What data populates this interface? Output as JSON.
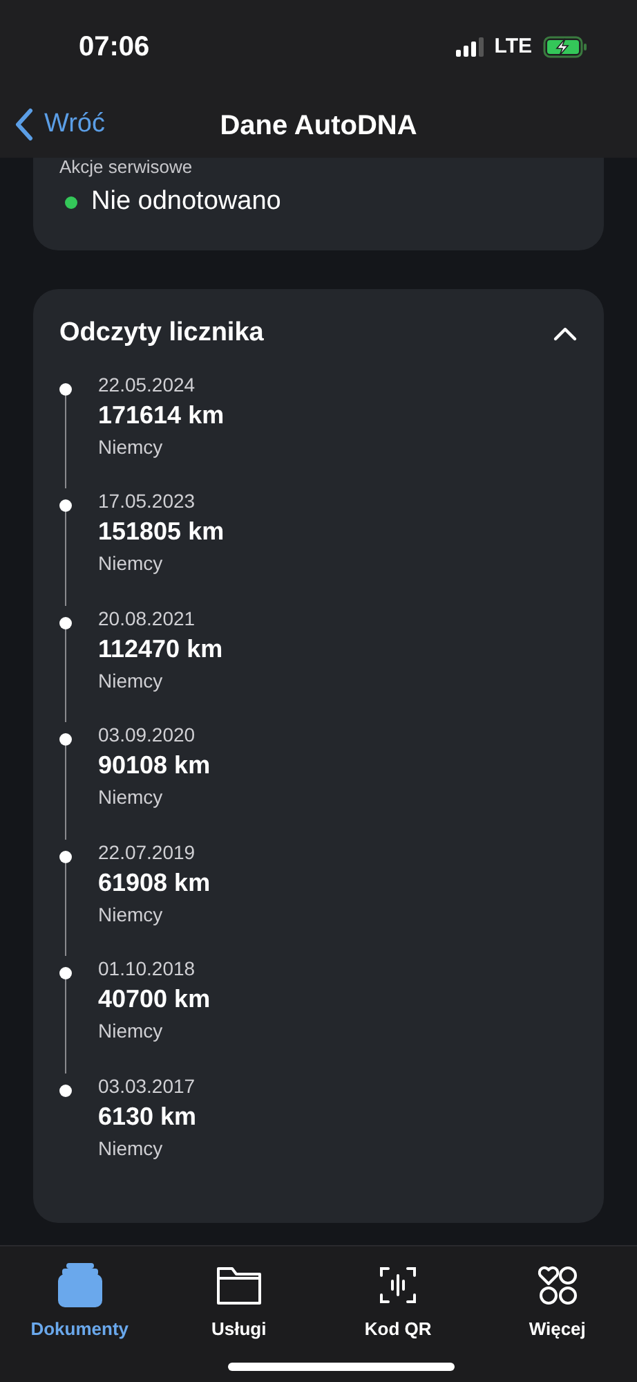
{
  "status_bar": {
    "time": "07:06",
    "network": "LTE"
  },
  "nav": {
    "back": "Wróć",
    "title": "Dane AutoDNA"
  },
  "service_card": {
    "label": "Akcje serwisowe",
    "value": "Nie odnotowano",
    "color": "#34c759"
  },
  "odometer": {
    "title": "Odczyty licznika",
    "expanded": true,
    "readings": [
      {
        "date": "22.05.2024",
        "mileage": "171614 km",
        "country": "Niemcy"
      },
      {
        "date": "17.05.2023",
        "mileage": "151805 km",
        "country": "Niemcy"
      },
      {
        "date": "20.08.2021",
        "mileage": "112470 km",
        "country": "Niemcy"
      },
      {
        "date": "03.09.2020",
        "mileage": "90108 km",
        "country": "Niemcy"
      },
      {
        "date": "22.07.2019",
        "mileage": "61908 km",
        "country": "Niemcy"
      },
      {
        "date": "01.10.2018",
        "mileage": "40700 km",
        "country": "Niemcy"
      },
      {
        "date": "03.03.2017",
        "mileage": "6130 km",
        "country": "Niemcy"
      }
    ]
  },
  "tab_bar": [
    {
      "label": "Dokumenty",
      "kind": "docs",
      "selected": true
    },
    {
      "label": "Usługi",
      "kind": "folder",
      "selected": false
    },
    {
      "label": "Kod QR",
      "kind": "qr",
      "selected": false
    },
    {
      "label": "Więcej",
      "kind": "more",
      "selected": false
    }
  ]
}
